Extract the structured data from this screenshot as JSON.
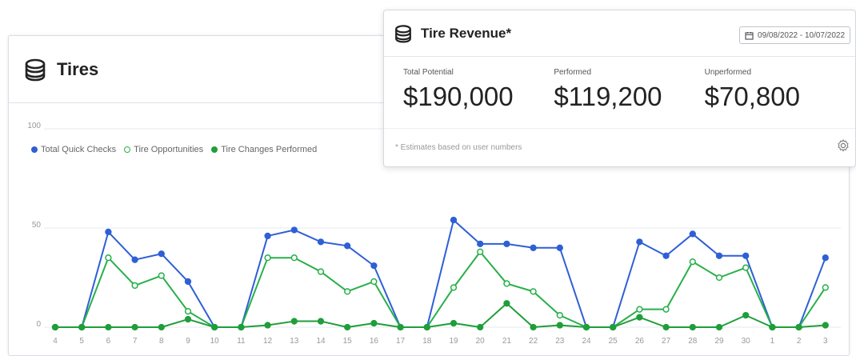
{
  "tires": {
    "title": "Tires",
    "icon": "tire-stack-icon"
  },
  "revenue": {
    "title": "Tire Revenue*",
    "icon": "tire-stack-icon",
    "date_range": "09/08/2022 - 10/07/2022",
    "stats": [
      {
        "label": "Total Potential",
        "value": "$190,000"
      },
      {
        "label": "Performed",
        "value": "$119,200"
      },
      {
        "label": "Unperformed",
        "value": "$70,800"
      }
    ],
    "footnote": "* Estimates based on user numbers",
    "settings_icon": "gear-icon"
  },
  "chart_data": {
    "type": "line",
    "ylim": [
      0,
      100
    ],
    "y_ticks": [
      "0",
      "50",
      "100"
    ],
    "categories": [
      "4",
      "5",
      "6",
      "7",
      "8",
      "9",
      "10",
      "11",
      "12",
      "13",
      "14",
      "15",
      "16",
      "17",
      "18",
      "19",
      "20",
      "21",
      "22",
      "23",
      "24",
      "25",
      "26",
      "27",
      "28",
      "29",
      "30",
      "1",
      "2",
      "3"
    ],
    "series": [
      {
        "name": "Total Quick Checks",
        "color": "#2f5fd6",
        "fill": true,
        "values": [
          0,
          0,
          48,
          34,
          37,
          23,
          0,
          0,
          46,
          49,
          43,
          41,
          31,
          0,
          0,
          54,
          42,
          42,
          40,
          40,
          0,
          0,
          43,
          36,
          47,
          36,
          36,
          0,
          0,
          35
        ]
      },
      {
        "name": "Tire Opportunities",
        "color": "#28b04a",
        "fill": false,
        "values": [
          0,
          0,
          35,
          21,
          26,
          8,
          0,
          0,
          35,
          35,
          28,
          18,
          23,
          0,
          0,
          20,
          38,
          22,
          18,
          6,
          0,
          0,
          9,
          9,
          33,
          25,
          30,
          0,
          0,
          20
        ]
      },
      {
        "name": "Tire Changes Performed",
        "color": "#1f9e3a",
        "fill": true,
        "values": [
          0,
          0,
          0,
          0,
          0,
          4,
          0,
          0,
          1,
          3,
          3,
          0,
          2,
          0,
          0,
          2,
          0,
          12,
          0,
          1,
          0,
          0,
          5,
          0,
          0,
          0,
          6,
          0,
          0,
          1
        ]
      }
    ]
  }
}
